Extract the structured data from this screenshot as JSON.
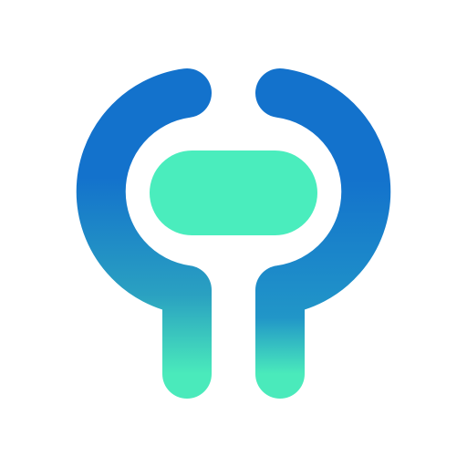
{
  "colors": {
    "background": "#ffffff",
    "gradient_top": "#1372cc",
    "gradient_mid": "#2a9fc2",
    "gradient_bottom": "#4aeabb",
    "capsule": "#4aedbd"
  },
  "icons": {
    "logo": "app-logo-icon"
  }
}
